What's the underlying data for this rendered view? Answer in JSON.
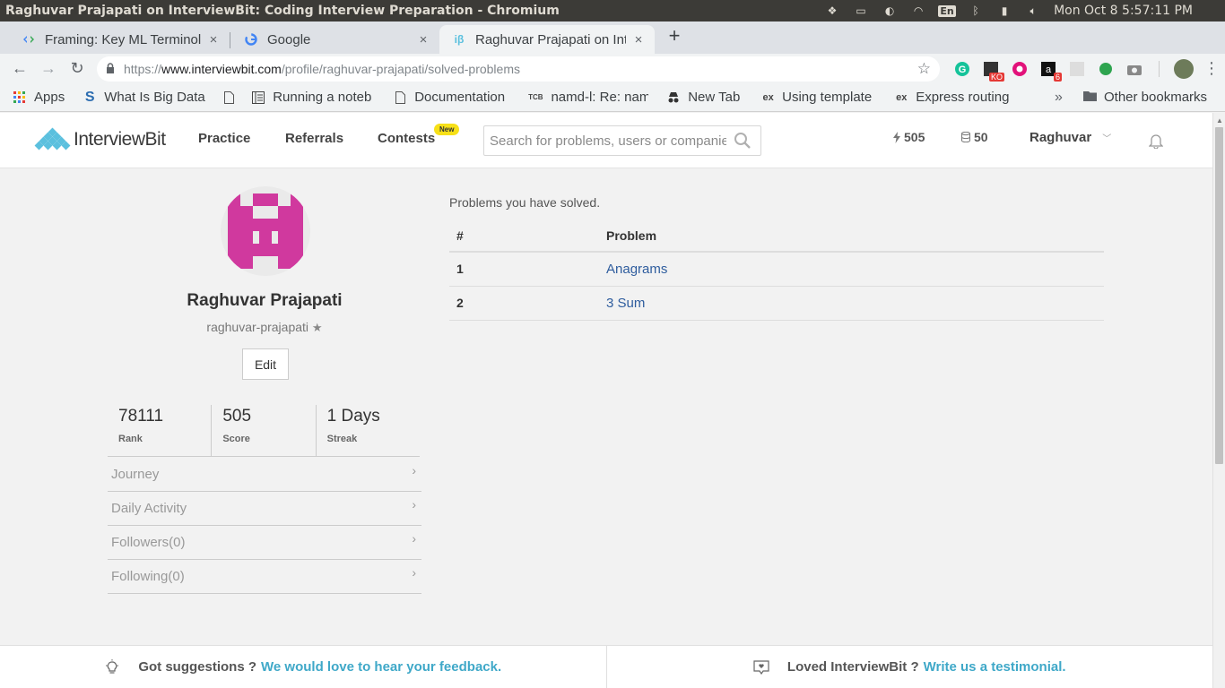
{
  "os": {
    "window_title": "Raghuvar Prajapati on InterviewBit: Coding Interview Preparation - Chromium",
    "lang": "En",
    "clock": "Mon Oct  8  5:57:11 PM"
  },
  "tabs": [
    {
      "label": "Framing: Key ML Terminol",
      "close": "×"
    },
    {
      "label": "Google",
      "close": "×"
    },
    {
      "label": "Raghuvar Prajapati on Int",
      "close": "×",
      "favicon": "iβ"
    }
  ],
  "new_tab": "+",
  "omnibox": {
    "scheme": "https://",
    "host": "www.interviewbit.com",
    "path": "/profile/raghuvar-prajapati/solved-problems"
  },
  "extensions": [
    {
      "name": "grammarly-icon",
      "glyph": "G",
      "color": "#15c39a"
    },
    {
      "name": "ko-icon",
      "glyph": "■",
      "badge": "KO",
      "color": "#333"
    },
    {
      "name": "eye-icon",
      "glyph": "◉",
      "color": "#e2127a"
    },
    {
      "name": "amazon-icon",
      "glyph": "a",
      "badge": "6",
      "color": "#111"
    },
    {
      "name": "grid-icon",
      "glyph": "▦",
      "color": "#ccc"
    },
    {
      "name": "leaf-icon",
      "glyph": "●",
      "color": "#2ea44f"
    },
    {
      "name": "camera-icon",
      "glyph": "◘",
      "color": "#777"
    }
  ],
  "bookmarks": [
    {
      "label": "Apps",
      "icon": "apps-grid-icon"
    },
    {
      "label": "What Is Big Data",
      "icon": "s-logo-icon"
    },
    {
      "label": "",
      "icon": "page-icon"
    },
    {
      "label": "Running a noteb",
      "icon": "notebook-icon"
    },
    {
      "label": "Documentation",
      "icon": "doc-icon"
    },
    {
      "label": "namd-l: Re: namd",
      "icon": "tcb-icon",
      "glyph": "TCB"
    },
    {
      "label": "New Tab",
      "icon": "incognito-icon"
    },
    {
      "label": "Using template e",
      "icon": "ex-icon",
      "glyph": "ex"
    },
    {
      "label": "Express routing",
      "icon": "ex-icon",
      "glyph": "ex"
    }
  ],
  "bookmarks_more": "»",
  "bookmarks_other": "Other bookmarks",
  "site": {
    "logo": {
      "word1": "Interview",
      "word2": "Bit"
    },
    "nav": [
      "Practice",
      "Referrals",
      "Contests"
    ],
    "new_badge": "New",
    "search_placeholder": "Search for problems, users or companies",
    "streak_stat": "505",
    "coins_stat": "50",
    "user_name": "Raghuvar"
  },
  "profile": {
    "name": "Raghuvar Prajapati",
    "handle": "raghuvar-prajapati",
    "edit_label": "Edit",
    "stats": [
      {
        "value": "78111",
        "label": "Rank"
      },
      {
        "value": "505",
        "label": "Score"
      },
      {
        "value": "1 Days",
        "label": "Streak"
      }
    ],
    "menu": [
      "Journey",
      "Daily Activity",
      "Followers(0)",
      "Following(0)"
    ]
  },
  "solved": {
    "title": "Problems you have solved.",
    "columns": [
      "#",
      "Problem"
    ],
    "rows": [
      {
        "num": "1",
        "problem": "Anagrams"
      },
      {
        "num": "2",
        "problem": "3 Sum"
      }
    ]
  },
  "footer": {
    "left_text": "Got suggestions ?",
    "left_link": "We would love to hear your feedback.",
    "right_text": "Loved InterviewBit ?",
    "right_link": "Write us a testimonial."
  },
  "colors": {
    "avatar_pink": "#d0399e",
    "link_blue": "#2f5d9e",
    "footer_link": "#3fa8c8",
    "logo_teal": "#5bc0de"
  }
}
